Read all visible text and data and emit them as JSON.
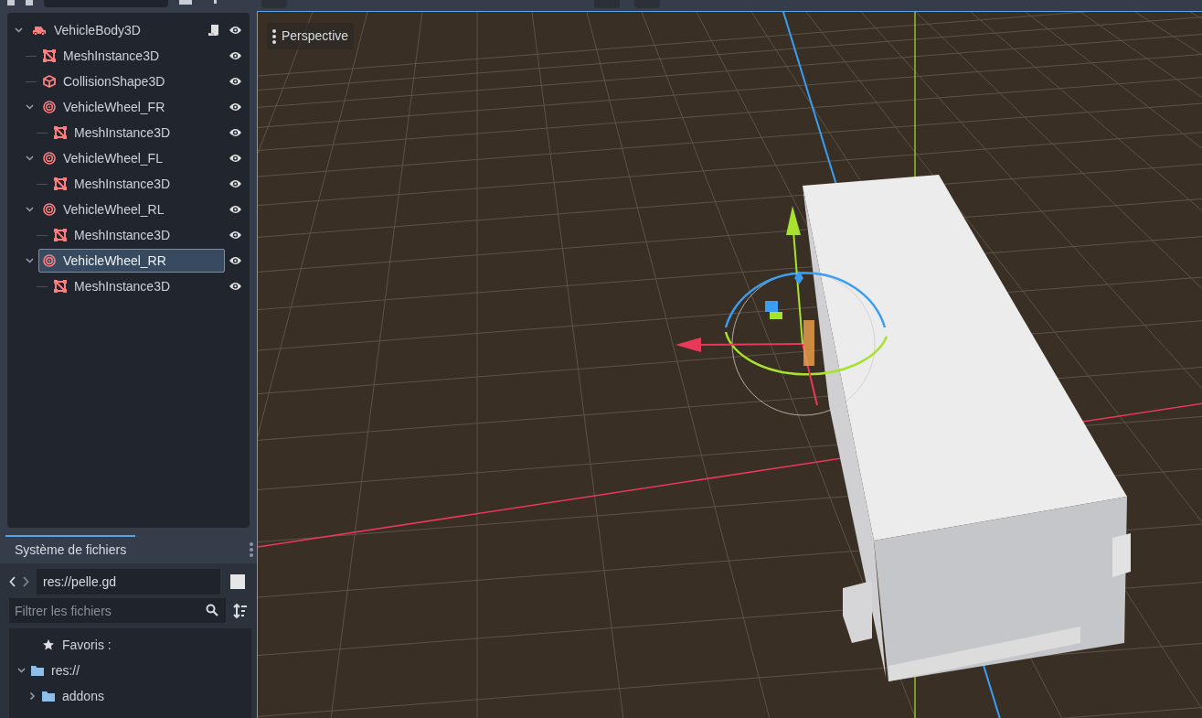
{
  "scene_tree": {
    "items": [
      {
        "label": "VehicleBody3D",
        "kind": "body",
        "expanded": true,
        "selected": false,
        "has_script": true,
        "visible": true,
        "children": [
          {
            "label": "MeshInstance3D",
            "kind": "mesh",
            "selected": false,
            "visible": true
          },
          {
            "label": "CollisionShape3D",
            "kind": "collision",
            "selected": false,
            "visible": true
          },
          {
            "label": "VehicleWheel_FR",
            "kind": "wheel",
            "expanded": true,
            "selected": false,
            "visible": true,
            "children": [
              {
                "label": "MeshInstance3D",
                "kind": "mesh",
                "selected": false,
                "visible": true
              }
            ]
          },
          {
            "label": "VehicleWheel_FL",
            "kind": "wheel",
            "expanded": true,
            "selected": false,
            "visible": true,
            "children": [
              {
                "label": "MeshInstance3D",
                "kind": "mesh",
                "selected": false,
                "visible": true
              }
            ]
          },
          {
            "label": "VehicleWheel_RL",
            "kind": "wheel",
            "expanded": true,
            "selected": false,
            "visible": true,
            "children": [
              {
                "label": "MeshInstance3D",
                "kind": "mesh",
                "selected": false,
                "visible": true
              }
            ]
          },
          {
            "label": "VehicleWheel_RR",
            "kind": "wheel",
            "expanded": true,
            "selected": true,
            "visible": true,
            "children": [
              {
                "label": "MeshInstance3D",
                "kind": "mesh",
                "selected": false,
                "visible": true
              }
            ]
          }
        ]
      }
    ]
  },
  "filesystem": {
    "tab": "Système de fichiers",
    "path": "res://pelle.gd",
    "filter_placeholder": "Filtrer les fichiers",
    "items": [
      {
        "label": "Favoris :",
        "kind": "favorites"
      },
      {
        "label": "res://",
        "kind": "folder",
        "expanded": true,
        "children": [
          {
            "label": "addons",
            "kind": "folder",
            "expanded": false
          }
        ]
      }
    ]
  },
  "viewport": {
    "view_menu": "Perspective"
  }
}
